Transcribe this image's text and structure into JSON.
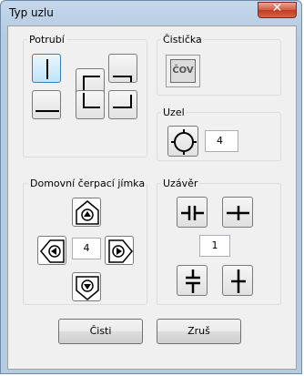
{
  "window": {
    "title": "Typ uzlu",
    "close_glyph": "✕"
  },
  "groups": {
    "potrubi": "Potrubí",
    "cisticka": "Čistička",
    "uzel": "Uzel",
    "jimka": "Domovní čerpací jímka",
    "uzaver": "Uzávěr"
  },
  "cisticka_icon_text": "ČOV",
  "uzel_value": "4",
  "jimka_value": "4",
  "uzaver_value": "1",
  "buttons": {
    "ok": "Čisti",
    "cancel": "Zruš"
  }
}
